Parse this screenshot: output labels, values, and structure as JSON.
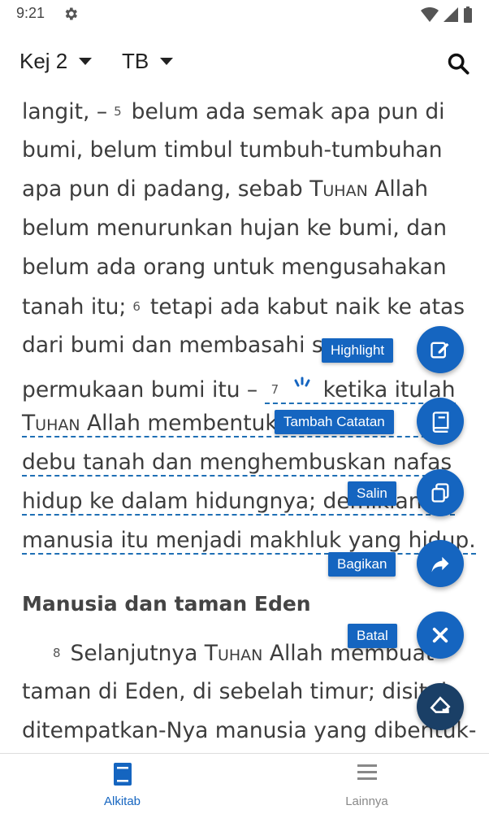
{
  "status_bar": {
    "time": "9:21"
  },
  "toolbar": {
    "book": "Kej 2",
    "version": "TB"
  },
  "content": {
    "l1a": "langit, –",
    "l1vn": "5",
    "l1b": "belum ada semak apa pun di",
    "l2": "bumi, belum timbul tumbuh-tumbuhan",
    "l3a": "apa pun di padang, sebab",
    "l3sc": "Tuhan",
    "l3b": "Allah",
    "l4": "belum menurunkan hujan ke bumi, dan",
    "l5": "belum ada orang untuk mengusahakan",
    "l6a": "tanah itu;",
    "l6vn": "6",
    "l6b": "tetapi ada kabut naik ke atas",
    "l7": "dari bumi dan membasahi se",
    "l8a": "permukaan bumi itu –",
    "l8vn": "7",
    "l8b": "ketika itulah",
    "l9sc": "Tuhan",
    "l9a": "Allah membentuk",
    "l9b": "da",
    "l10": "debu tanah dan menghembuskan nafas",
    "l11a": "hidup ke dalam hidungnya; de",
    "l11b": "mikianlah",
    "l12": "manusia itu menjadi makhluk yang hidup.",
    "heading": "Manusia dan taman Eden",
    "l13vn": "8",
    "l13a": "Selanjutnya",
    "l13sc": "Tuhan",
    "l13b": "Allah membuat",
    "l14": "taman di Eden, di sebelah timur; disitul",
    "l15": "ditempatkan-Nya manusia yang dibentuk-"
  },
  "fab_menu": {
    "highlight": "Highlight",
    "note": "Tambah Catatan",
    "copy": "Salin",
    "share": "Bagikan",
    "cancel": "Batal"
  },
  "bottom_nav": {
    "bible": "Alkitab",
    "more": "Lainnya"
  },
  "colors": {
    "accent": "#1565c0",
    "dark_fab": "#1a3f66"
  }
}
